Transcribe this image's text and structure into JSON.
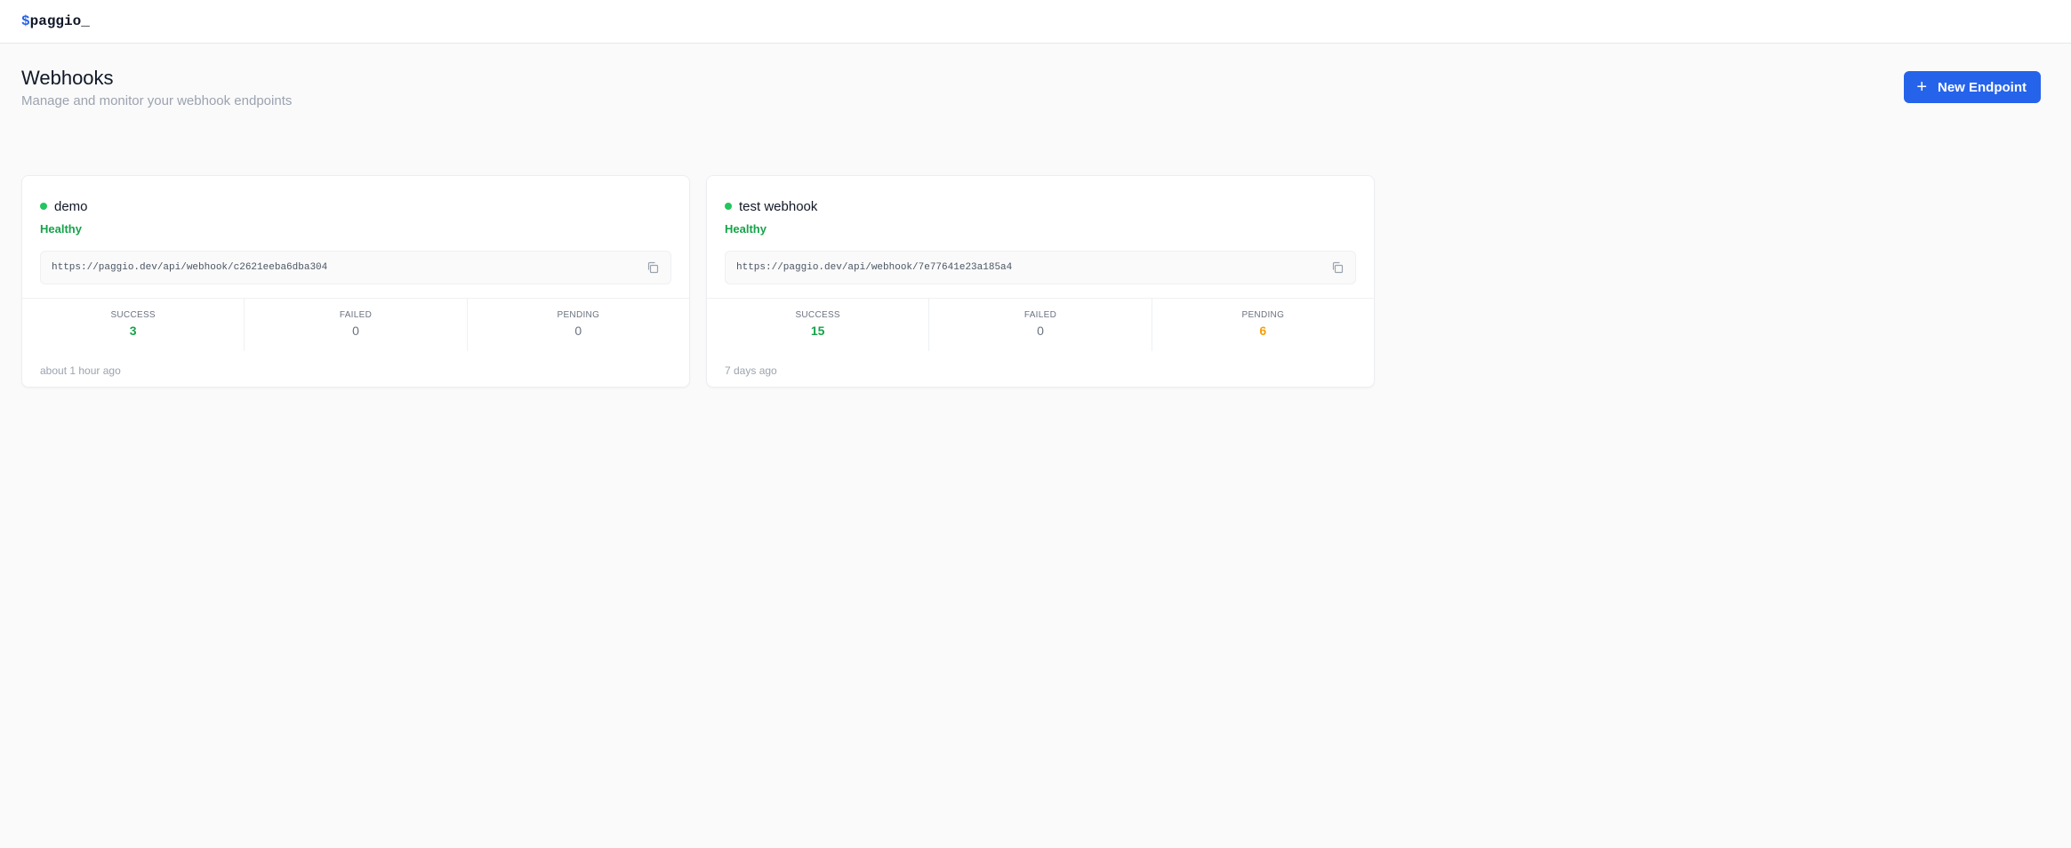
{
  "header": {
    "logo_prefix": "$",
    "logo_text": "paggio_"
  },
  "page": {
    "title": "Webhooks",
    "subtitle": "Manage and monitor your webhook endpoints",
    "new_button_label": "New Endpoint"
  },
  "icons": {
    "plus": "plus-icon",
    "copy": "copy-icon",
    "status": "status-dot"
  },
  "colors": {
    "accent": "#2563eb",
    "healthy": "#22c55e",
    "success": "#16a34a",
    "pending": "#f59e0b"
  },
  "webhooks": [
    {
      "name": "demo",
      "status": "Healthy",
      "url": "https://paggio.dev/api/webhook/c2621eeba6dba304",
      "stats": {
        "success_label": "SUCCESS",
        "success": "3",
        "failed_label": "FAILED",
        "failed": "0",
        "pending_label": "PENDING",
        "pending": "0"
      },
      "updated": "about 1 hour ago"
    },
    {
      "name": "test webhook",
      "status": "Healthy",
      "url": "https://paggio.dev/api/webhook/7e77641e23a185a4",
      "stats": {
        "success_label": "SUCCESS",
        "success": "15",
        "failed_label": "FAILED",
        "failed": "0",
        "pending_label": "PENDING",
        "pending": "6"
      },
      "updated": "7 days ago"
    }
  ]
}
